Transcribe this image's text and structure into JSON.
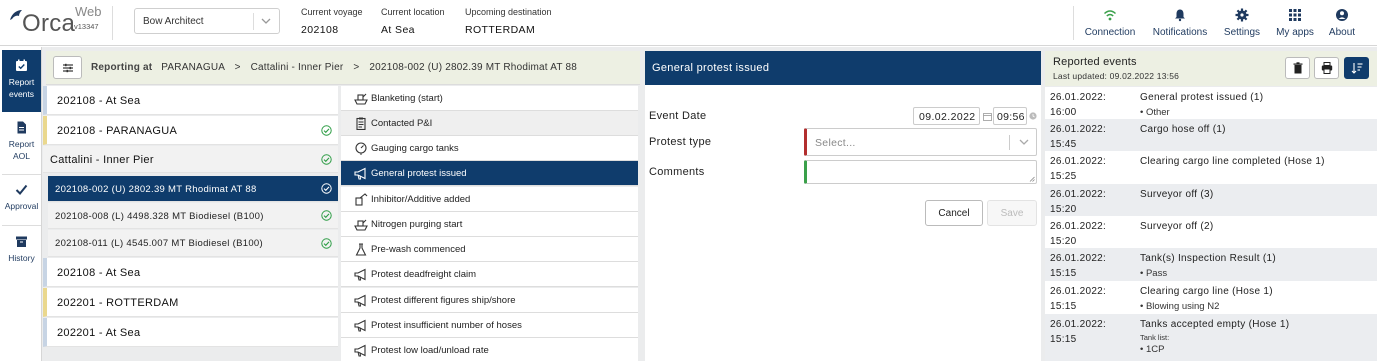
{
  "app": {
    "name": "Orca",
    "suffix": "Web",
    "version": "v13347"
  },
  "ship_select": {
    "value": "Bow Architect"
  },
  "header_info": [
    {
      "label": "Current voyage",
      "value": "202108"
    },
    {
      "label": "Current location",
      "value": "At Sea"
    },
    {
      "label": "Upcoming destination",
      "value": "ROTTERDAM"
    }
  ],
  "nav": [
    {
      "label": "Connection",
      "icon": "wifi-icon"
    },
    {
      "label": "Notifications",
      "icon": "bell-icon"
    },
    {
      "label": "Settings",
      "icon": "gear-icon"
    },
    {
      "label": "My apps",
      "icon": "grid-icon"
    },
    {
      "label": "About",
      "icon": "user-icon"
    }
  ],
  "rail": [
    {
      "label": "Report events",
      "line1": "Report",
      "line2": "events",
      "icon": "calendar-icon",
      "active": true
    },
    {
      "label": "Report AOL",
      "line1": "Report",
      "line2": "AOL",
      "icon": "document-icon",
      "active": false
    },
    {
      "label": "Approval",
      "line1": "Approval",
      "line2": "",
      "icon": "checkmark-icon",
      "active": false
    },
    {
      "label": "History",
      "line1": "History",
      "line2": "",
      "icon": "archive-icon",
      "active": false
    }
  ],
  "breadcrumb": {
    "prefix": "Reporting at",
    "parts": [
      "PARANAGUA",
      "Cattalini - Inner Pier",
      "202108-002 (U) 2802.39 MT Rhodimat AT 88"
    ],
    "separator": ">"
  },
  "voyages": [
    {
      "label": "202108 - At Sea",
      "bar": "blue",
      "style": "white",
      "check": false
    },
    {
      "label": "202108 - PARANAGUA",
      "bar": "yellow",
      "style": "white",
      "check": true
    },
    {
      "label": "Cattalini - Inner Pier",
      "bar": "none",
      "style": "grey",
      "check": true
    },
    {
      "label": "202108-002 (U) 2802.39 MT Rhodimat AT 88",
      "bar": "none",
      "style": "selected",
      "check": true
    },
    {
      "label": "202108-008 (L) 4498.328 MT Biodiesel (B100)",
      "bar": "none",
      "style": "grey",
      "check": true
    },
    {
      "label": "202108-011 (L) 4545.007 MT Biodiesel (B100)",
      "bar": "none",
      "style": "grey",
      "check": true
    },
    {
      "label": "202108 - At Sea",
      "bar": "blue",
      "style": "white",
      "check": false
    },
    {
      "label": "202201 - ROTTERDAM",
      "bar": "yellow",
      "style": "white",
      "check": false
    },
    {
      "label": "202201 - At Sea",
      "bar": "blue",
      "style": "white",
      "check": false
    }
  ],
  "event_types": [
    {
      "label": "Blanketing (start)",
      "icon": "ship-icon",
      "state": "normal"
    },
    {
      "label": "Contacted P&I",
      "icon": "clipboard-icon",
      "state": "hover"
    },
    {
      "label": "Gauging cargo tanks",
      "icon": "gauge-icon",
      "state": "normal"
    },
    {
      "label": "General protest issued",
      "icon": "megaphone-icon",
      "state": "selected"
    },
    {
      "label": "Inhibitor/Additive added",
      "icon": "additive-icon",
      "state": "normal"
    },
    {
      "label": "Nitrogen purging start",
      "icon": "ship-icon",
      "state": "normal"
    },
    {
      "label": "Pre-wash commenced",
      "icon": "flask-icon",
      "state": "normal"
    },
    {
      "label": "Protest deadfreight claim",
      "icon": "megaphone-icon",
      "state": "normal"
    },
    {
      "label": "Protest different figures ship/shore",
      "icon": "megaphone-icon",
      "state": "normal"
    },
    {
      "label": "Protest insufficient number of hoses",
      "icon": "megaphone-icon",
      "state": "normal"
    },
    {
      "label": "Protest low load/unload rate",
      "icon": "megaphone-icon",
      "state": "normal"
    }
  ],
  "form": {
    "title": "General protest issued",
    "event_date_label": "Event Date",
    "date": "09.02.2022",
    "time": "09:56",
    "protest_type_label": "Protest type",
    "protest_type_placeholder": "Select...",
    "comments_label": "Comments",
    "cancel": "Cancel",
    "save": "Save"
  },
  "reported": {
    "title": "Reported events",
    "updated": "Last updated: 09.02.2022 13:56",
    "events": [
      {
        "date": "26.01.2022:",
        "time": "16:00",
        "title": "General protest issued (1)",
        "sub": "• Other"
      },
      {
        "date": "26.01.2022:",
        "time": "15:45",
        "title": "Cargo hose off (1)",
        "sub": ""
      },
      {
        "date": "26.01.2022:",
        "time": "15:25",
        "title": "Clearing cargo line completed (Hose 1)",
        "sub": ""
      },
      {
        "date": "26.01.2022:",
        "time": "15:20",
        "title": "Surveyor off (3)",
        "sub": ""
      },
      {
        "date": "26.01.2022:",
        "time": "15:20",
        "title": "Surveyor off (2)",
        "sub": ""
      },
      {
        "date": "26.01.2022:",
        "time": "15:15",
        "title": "Tank(s) Inspection Result (1)",
        "sub": "• Pass"
      },
      {
        "date": "26.01.2022:",
        "time": "15:15",
        "title": "Clearing cargo line (Hose 1)",
        "sub": "• Blowing using N2"
      },
      {
        "date": "26.01.2022:",
        "time": "15:15",
        "title": "Tanks accepted empty (Hose 1)",
        "sub_small": "Tank list:",
        "sub": "• 1CP"
      }
    ]
  },
  "colors": {
    "navy": "#0f3c6c",
    "accent_green": "#3aa04a",
    "required_red": "#b22e2e",
    "check_green": "#2e9d46"
  }
}
